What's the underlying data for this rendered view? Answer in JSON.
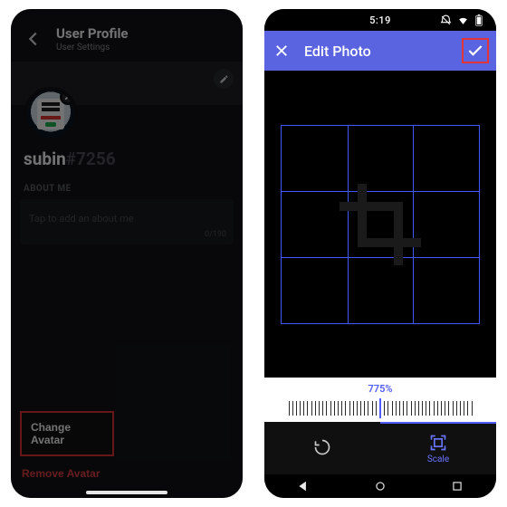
{
  "left": {
    "header_title": "User Profile",
    "header_sub": "User Settings",
    "username": "subin",
    "discriminator": "#7256",
    "about_label": "ABOUT ME",
    "about_placeholder": "Tap to add an about me",
    "about_counter": "0/190",
    "change_avatar": "Change Avatar",
    "remove_avatar": "Remove Avatar"
  },
  "right": {
    "status_time": "5:19",
    "title": "Edit Photo",
    "scale_pct": "775%",
    "rotate_label": "",
    "scale_label": "Scale"
  }
}
